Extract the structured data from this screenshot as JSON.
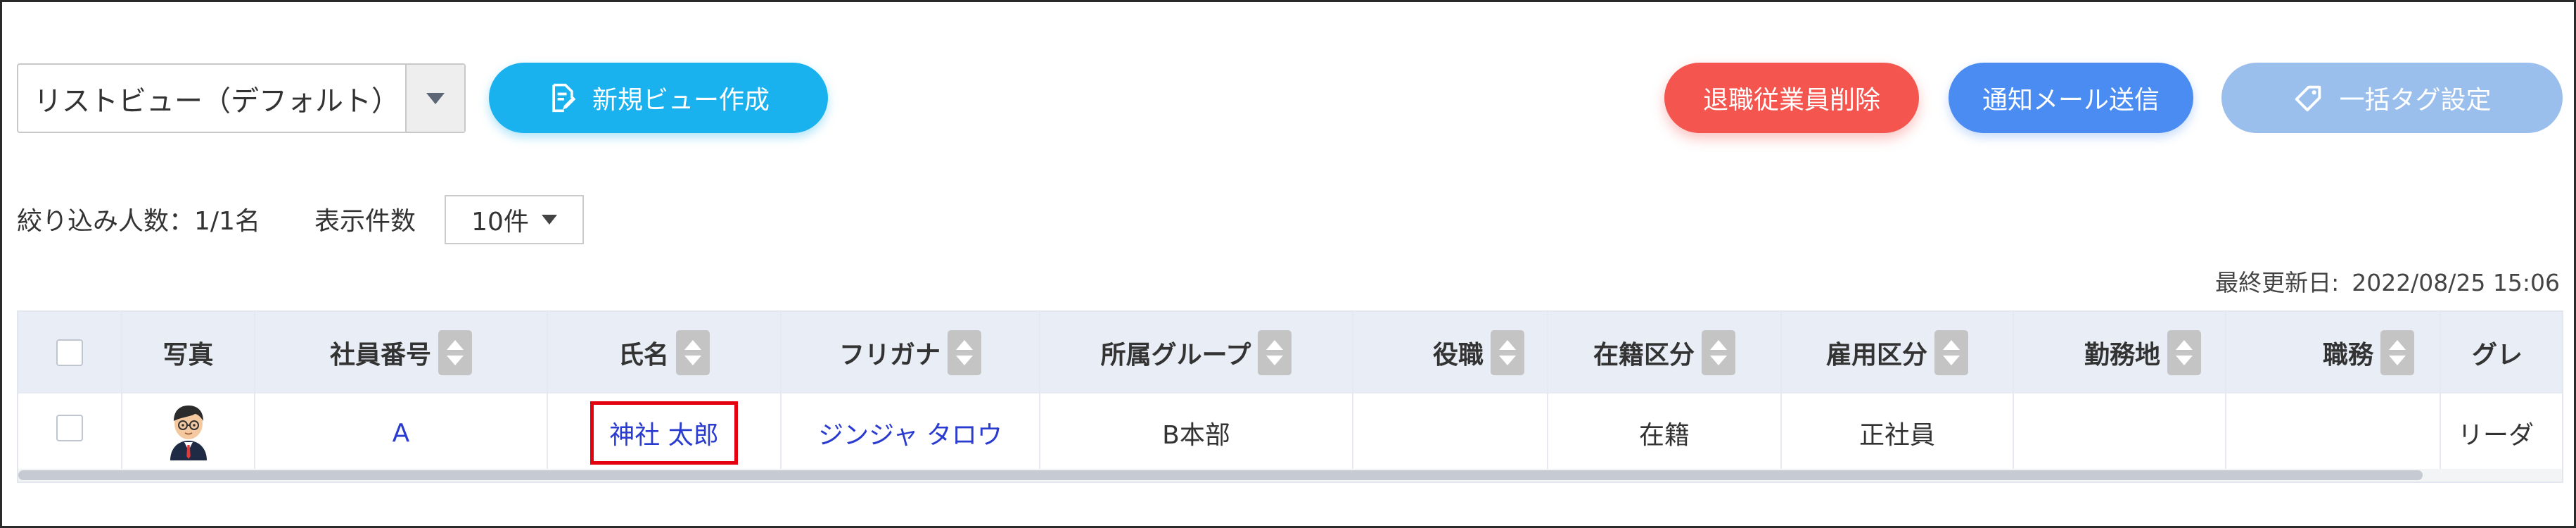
{
  "toolbar": {
    "view_select_value": "リストビュー（デフォルト）",
    "new_view_label": "新規ビュー作成",
    "retire_delete_label": "退職従業員削除",
    "notify_mail_label": "通知メール送信",
    "bulk_tag_label": "一括タグ設定"
  },
  "filter": {
    "count_label": "絞り込み人数：1/1名",
    "per_page_label": "表示件数",
    "per_page_value": "10件"
  },
  "last_updated": {
    "label": "最終更新日:",
    "value": "2022/08/25 15:06"
  },
  "table": {
    "columns": [
      "",
      "写真",
      "社員番号",
      "氏名",
      "フリガナ",
      "所属グループ",
      "役職",
      "在籍区分",
      "雇用区分",
      "勤務地",
      "職務",
      "グレ"
    ],
    "row": {
      "employee_number": "A",
      "name": "神社 太郎",
      "furigana": "ジンジャ タロウ",
      "group": "B本部",
      "position": "",
      "enrollment": "在籍",
      "employment_type": "正社員",
      "workplace": "",
      "job": "",
      "grade": "リーダ"
    }
  },
  "colors": {
    "accent_blue": "#19b2ee",
    "danger_red": "#f4564f",
    "mail_blue": "#4a8cf2",
    "disabled_blue": "#9bbfec",
    "highlight_red": "#e3000f",
    "link_blue": "#2a3bd0"
  },
  "icons": [
    "chevron-down-icon",
    "edit-document-icon",
    "tag-icon",
    "sort-icon",
    "avatar-icon"
  ]
}
